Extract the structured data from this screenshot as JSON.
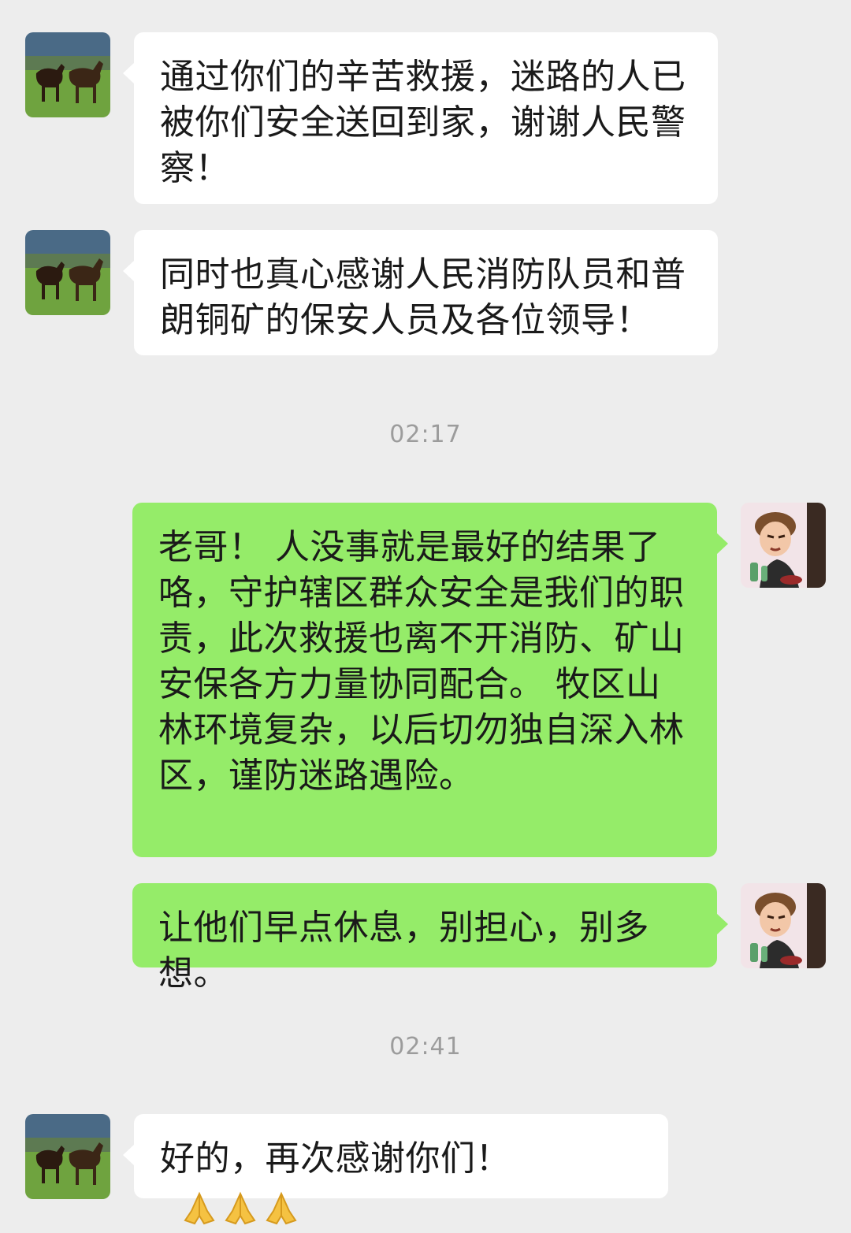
{
  "messages": [
    {
      "id": "m1",
      "sender": "contact",
      "text": "通过你们的辛苦救援，迷路的人已被你们安全送回到家，谢谢人民警察！"
    },
    {
      "id": "m2",
      "sender": "contact",
      "text": "同时也真心感谢人民消防队员和普朗铜矿的保安人员及各位领导！"
    },
    {
      "id": "m3",
      "sender": "self",
      "text": "老哥！ 人没事就是最好的结果了咯，守护辖区群众安全是我们的职责，此次救援也离不开消防、矿山安保各方力量协同配合。 牧区山林环境复杂，以后切勿独自深入林区，谨防迷路遇险。"
    },
    {
      "id": "m4",
      "sender": "self",
      "text": "让他们早点休息，别担心，别多想。"
    },
    {
      "id": "m5",
      "sender": "contact",
      "text": "好的，再次感谢你们！",
      "emoji": [
        "folded-hands",
        "folded-hands",
        "folded-hands"
      ]
    }
  ],
  "timestamps": {
    "t1": "02:17",
    "t2": "02:41"
  },
  "colors": {
    "background": "#ededed",
    "incoming_bubble": "#ffffff",
    "outgoing_bubble": "#95ec69",
    "timestamp_text": "#9c9c9c"
  },
  "avatars": {
    "contact": "horses-in-field-avatar",
    "self": "cartoon-man-avatar"
  }
}
